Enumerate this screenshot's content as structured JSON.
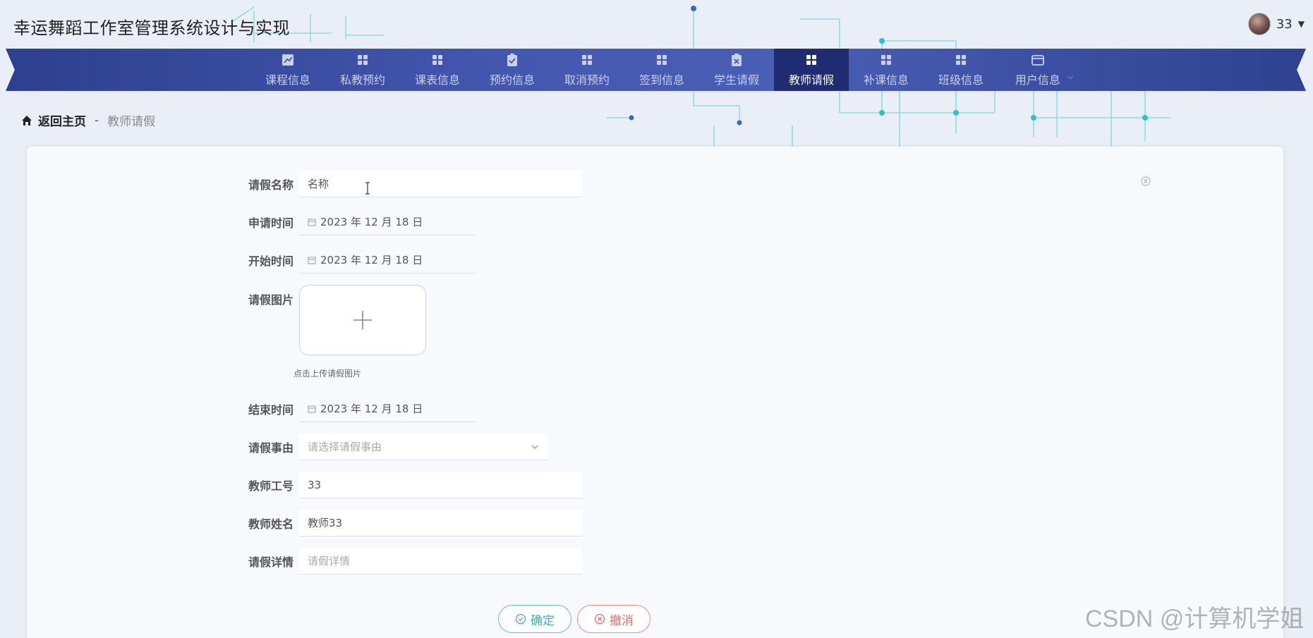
{
  "app": {
    "title": "幸运舞蹈工作室管理系统设计与实现"
  },
  "user": {
    "name": "33",
    "avatar": "avatar-photo"
  },
  "nav": {
    "active": "教师请假",
    "items": [
      {
        "label": "课程信息",
        "icon": "chart-icon"
      },
      {
        "label": "私教预约",
        "icon": "grid-icon"
      },
      {
        "label": "课表信息",
        "icon": "grid-icon"
      },
      {
        "label": "预约信息",
        "icon": "clipboard-check-icon"
      },
      {
        "label": "取消预约",
        "icon": "grid-icon"
      },
      {
        "label": "签到信息",
        "icon": "grid-icon"
      },
      {
        "label": "学生请假",
        "icon": "clipboard-x-icon"
      },
      {
        "label": "教师请假",
        "icon": "grid-icon"
      },
      {
        "label": "补课信息",
        "icon": "grid-icon"
      },
      {
        "label": "班级信息",
        "icon": "grid-icon"
      },
      {
        "label": "用户信息",
        "icon": "wallet-icon"
      }
    ]
  },
  "breadcrumb": {
    "home": "返回主页",
    "separator": "-",
    "current": "教师请假"
  },
  "form": {
    "leave_name": {
      "label": "请假名称",
      "value": "名称"
    },
    "apply_time": {
      "label": "申请时间",
      "value": "2023 年 12 月 18 日"
    },
    "start_time": {
      "label": "开始时间",
      "value": "2023 年 12 月 18 日"
    },
    "leave_image": {
      "label": "请假图片",
      "hint": "点击上传请假图片"
    },
    "end_time": {
      "label": "结束时间",
      "value": "2023 年 12 月 18 日"
    },
    "leave_reason": {
      "label": "请假事由",
      "placeholder": "请选择请假事由"
    },
    "teacher_id": {
      "label": "教师工号",
      "value": "33"
    },
    "teacher_name": {
      "label": "教师姓名",
      "value": "教师33"
    },
    "leave_detail": {
      "label": "请假详情",
      "placeholder": "请假详情"
    }
  },
  "buttons": {
    "confirm": "确定",
    "cancel": "撤消"
  },
  "watermark": "CSDN @计算机学姐",
  "colors": {
    "nav_bg": "#4558b0",
    "nav_active": "#1f2c72",
    "confirm": "#3aaec5",
    "cancel": "#e36a6a",
    "deco_line": "#28c4c8"
  }
}
